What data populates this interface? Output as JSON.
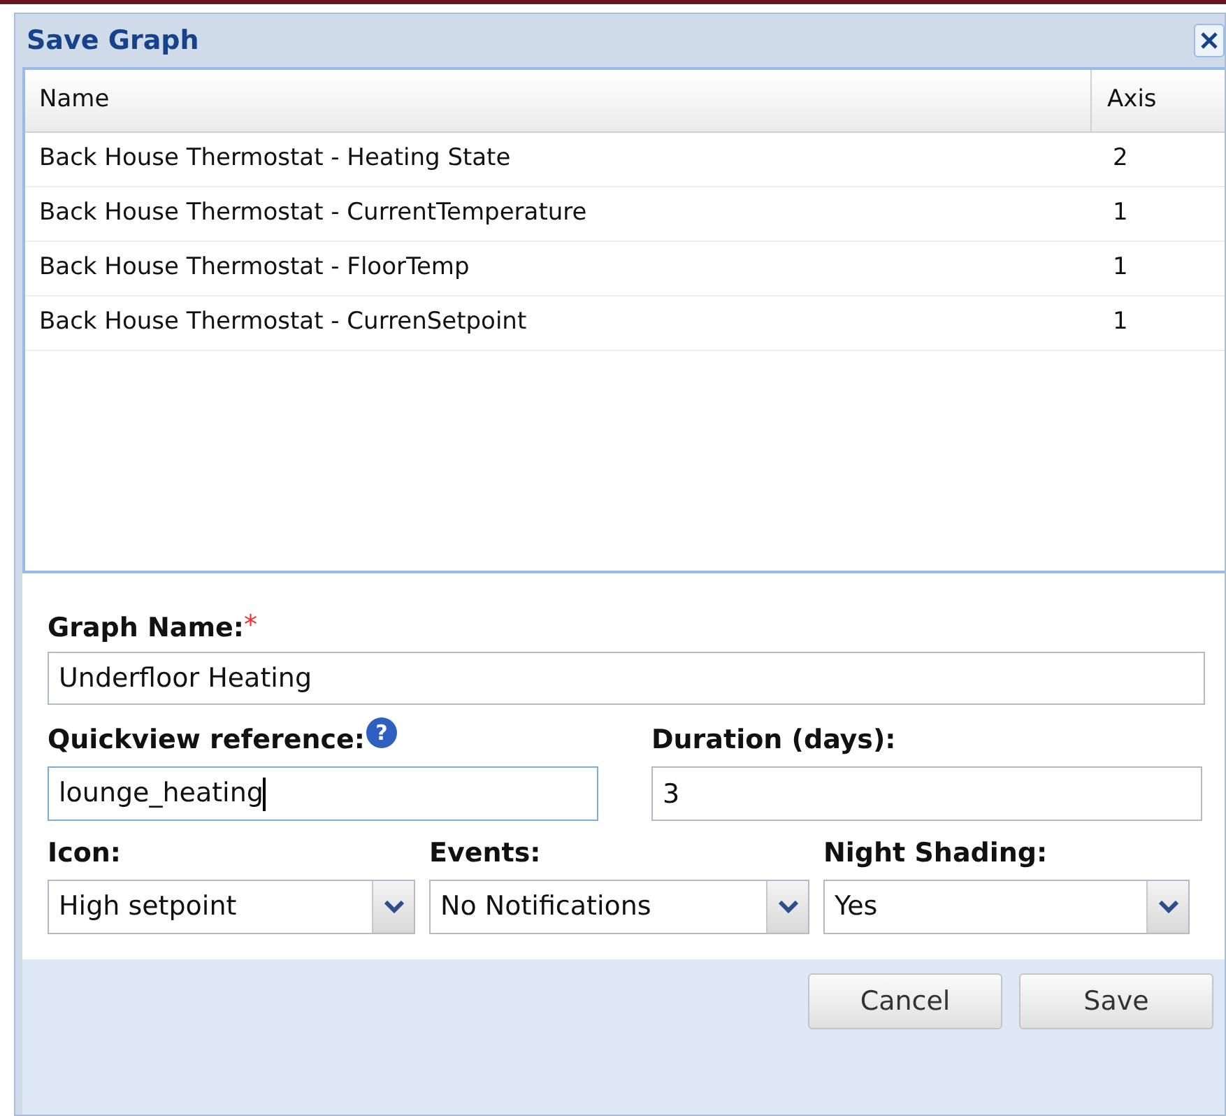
{
  "window": {
    "title": "Save Graph"
  },
  "table": {
    "columns": [
      "Name",
      "Axis"
    ],
    "rows": [
      [
        "Back House Thermostat - Heating State",
        "2"
      ],
      [
        "Back House Thermostat - CurrentTemperature",
        "1"
      ],
      [
        "Back House Thermostat - FloorTemp",
        "1"
      ],
      [
        "Back House Thermostat - CurrenSetpoint",
        "1"
      ]
    ]
  },
  "form": {
    "graph_name": {
      "label": "Graph Name:",
      "required": true,
      "marker": "*",
      "value": "Underfloor Heating"
    },
    "quickview": {
      "label": "Quickview reference:",
      "help": "?",
      "value": "lounge_heating",
      "focused": true
    },
    "duration": {
      "label": "Duration (days):",
      "value": "3"
    },
    "selects": [
      {
        "label": "Icon:",
        "value": "High setpoint"
      },
      {
        "label": "Events:",
        "value": "No Notifications"
      },
      {
        "label": "Night Shading:",
        "value": "Yes"
      }
    ]
  },
  "buttons": [
    "Cancel",
    "Save"
  ]
}
